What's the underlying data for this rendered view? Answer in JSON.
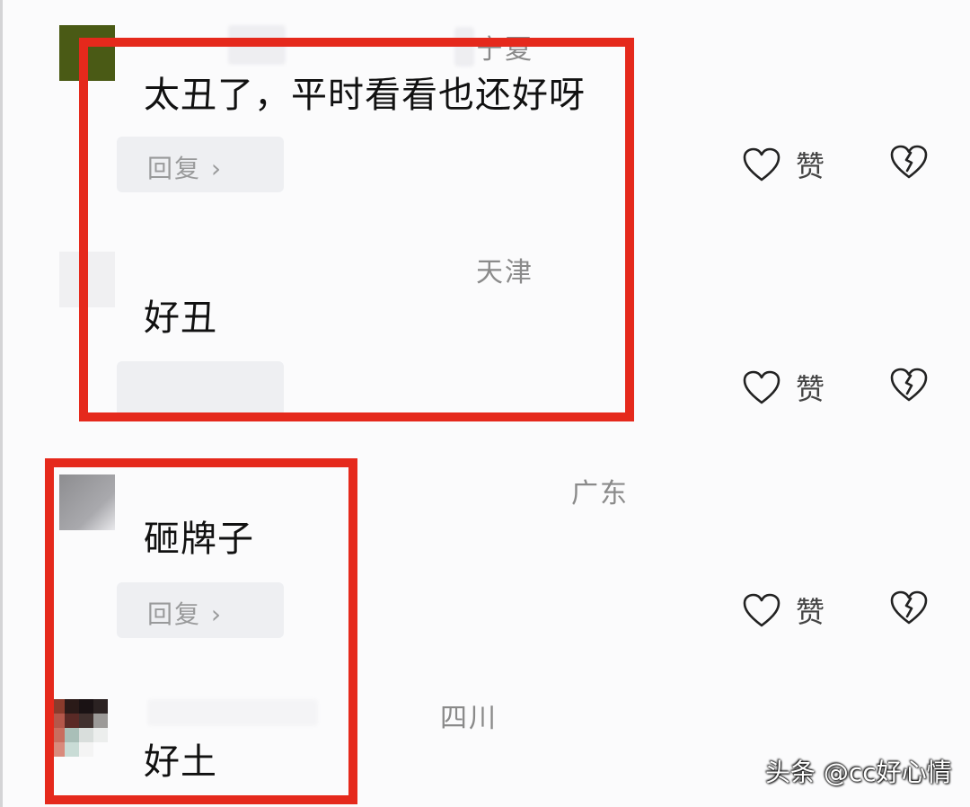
{
  "comments": [
    {
      "location": "宁夏",
      "text": "太丑了，平时看看也还好呀",
      "reply_label": "回复 ›",
      "like_label": "赞"
    },
    {
      "location": "天津",
      "text": "好丑",
      "like_label": "赞"
    },
    {
      "location": "广东",
      "text": "砸牌子",
      "reply_label": "回复 ›",
      "like_label": "赞"
    },
    {
      "location": "四川",
      "text": "好土"
    }
  ],
  "watermark": "头条 @cc好心情",
  "colors": {
    "highlight_border": "#e5291c",
    "background": "#fbfbfc",
    "location_text": "#8a8a8a"
  },
  "icons": {
    "like": "heart-outline-icon",
    "dislike": "broken-heart-icon"
  }
}
